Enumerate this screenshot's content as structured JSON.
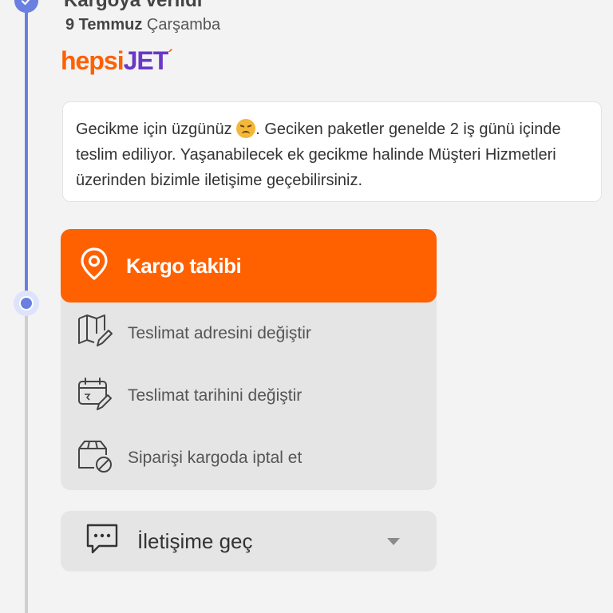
{
  "timeline": {
    "status_title": "Kargoya verildi",
    "date_day": "9 Temmuz",
    "date_weekday": "Çarşamba"
  },
  "carrier": {
    "logo_part1": "hepsi",
    "logo_part2": "JET"
  },
  "notice": {
    "text_before_emoji": "Gecikme için üzgünüz ",
    "text_after_emoji": ". Geciken paketler genelde 2 iş günü içinde teslim ediliyor. Yaşanabilecek ek gecikme halinde Müşteri Hizmetleri üzerinden bizimle iletişime geçebilirsiniz.",
    "emoji": "disappointed-face"
  },
  "actions": {
    "primary_label": "Kargo takibi",
    "items": [
      {
        "label": "Teslimat adresini değiştir",
        "icon": "map-edit-icon"
      },
      {
        "label": "Teslimat tarihini değiştir",
        "icon": "calendar-edit-icon"
      },
      {
        "label": "Siparişi kargoda iptal et",
        "icon": "box-cancel-icon"
      }
    ]
  },
  "contact": {
    "label": "İletişime geç",
    "icon": "chat-icon"
  },
  "colors": {
    "accent": "#ff6000",
    "timeline": "#6a7fe0",
    "brand_purple": "#6a38c7"
  }
}
